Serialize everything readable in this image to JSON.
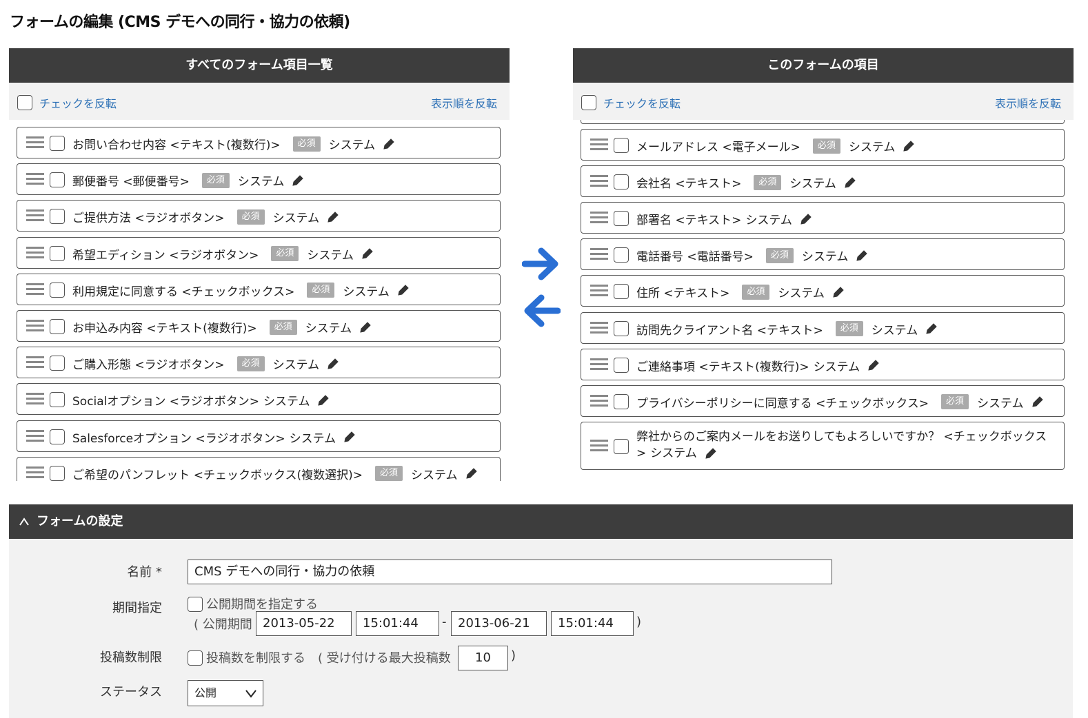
{
  "page_title": "フォームの編集 (CMS デモへの同行・協力の依頼)",
  "left_panel": {
    "title": "すべてのフォーム項目一覧",
    "invert_check": "チェックを反転",
    "invert_order": "表示順を反転",
    "items": [
      {
        "label": "お問い合わせ内容 <テキスト(複数行)>",
        "required": "必須",
        "system": "システム"
      },
      {
        "label": "郵便番号 <郵便番号>",
        "required": "必須",
        "system": "システム"
      },
      {
        "label": "ご提供方法 <ラジオボタン>",
        "required": "必須",
        "system": "システム"
      },
      {
        "label": "希望エディション <ラジオボタン>",
        "required": "必須",
        "system": "システム"
      },
      {
        "label": "利用規定に同意する <チェックボックス>",
        "required": "必須",
        "system": "システム"
      },
      {
        "label": "お申込み内容 <テキスト(複数行)>",
        "required": "必須",
        "system": "システム"
      },
      {
        "label": "ご購入形態 <ラジオボタン>",
        "required": "必須",
        "system": "システム"
      },
      {
        "label": "Socialオプション <ラジオボタン>",
        "required": "",
        "system": "システム"
      },
      {
        "label": "Salesforceオプション <ラジオボタン>",
        "required": "",
        "system": "システム"
      },
      {
        "label": "ご希望のパンフレット <チェックボックス(複数選択)>",
        "required": "必須",
        "system": "システム"
      }
    ]
  },
  "right_panel": {
    "title": "このフォームの項目",
    "invert_check": "チェックを反転",
    "invert_order": "表示順を反転",
    "items": [
      {
        "label": "メールアドレス <電子メール>",
        "required": "必須",
        "system": "システム"
      },
      {
        "label": "会社名 <テキスト>",
        "required": "必須",
        "system": "システム"
      },
      {
        "label": "部署名 <テキスト>",
        "required": "",
        "system": "システム"
      },
      {
        "label": "電話番号 <電話番号>",
        "required": "必須",
        "system": "システム"
      },
      {
        "label": "住所 <テキスト>",
        "required": "必須",
        "system": "システム"
      },
      {
        "label": "訪問先クライアント名 <テキスト>",
        "required": "必須",
        "system": "システム"
      },
      {
        "label": "ご連絡事項 <テキスト(複数行)>",
        "required": "",
        "system": "システム"
      },
      {
        "label": "プライバシーポリシーに同意する <チェックボックス>",
        "required": "必須",
        "system": "システム"
      },
      {
        "label": "弊社からのご案内メールをお送りしてもよろしいですか？ <チェックボックス>",
        "required": "",
        "system": "システム"
      }
    ]
  },
  "settings": {
    "header": "フォームの設定",
    "name_label": "名前 *",
    "name_value": "CMS デモへの同行・協力の依頼",
    "period_label": "期間指定",
    "period_checkbox_label": "公開期間を指定する",
    "period_prefix": "( 公開期間",
    "start_date": "2013-05-22",
    "start_time": "15:01:44",
    "dash": "-",
    "end_date": "2013-06-21",
    "end_time": "15:01:44",
    "period_suffix": ")",
    "limit_label": "投稿数制限",
    "limit_checkbox_label": "投稿数を制限する",
    "limit_prefix": "( 受け付ける最大投稿数",
    "limit_value": "10",
    "limit_suffix": ")",
    "status_label": "ステータス",
    "status_value": "公開"
  },
  "colors": {
    "header_bg": "#3d3d3d",
    "toolbar_bg": "#f2f2f2",
    "link": "#2a6fb5",
    "arrow": "#2a6fd4",
    "badge_bg": "#aaaaaa"
  }
}
